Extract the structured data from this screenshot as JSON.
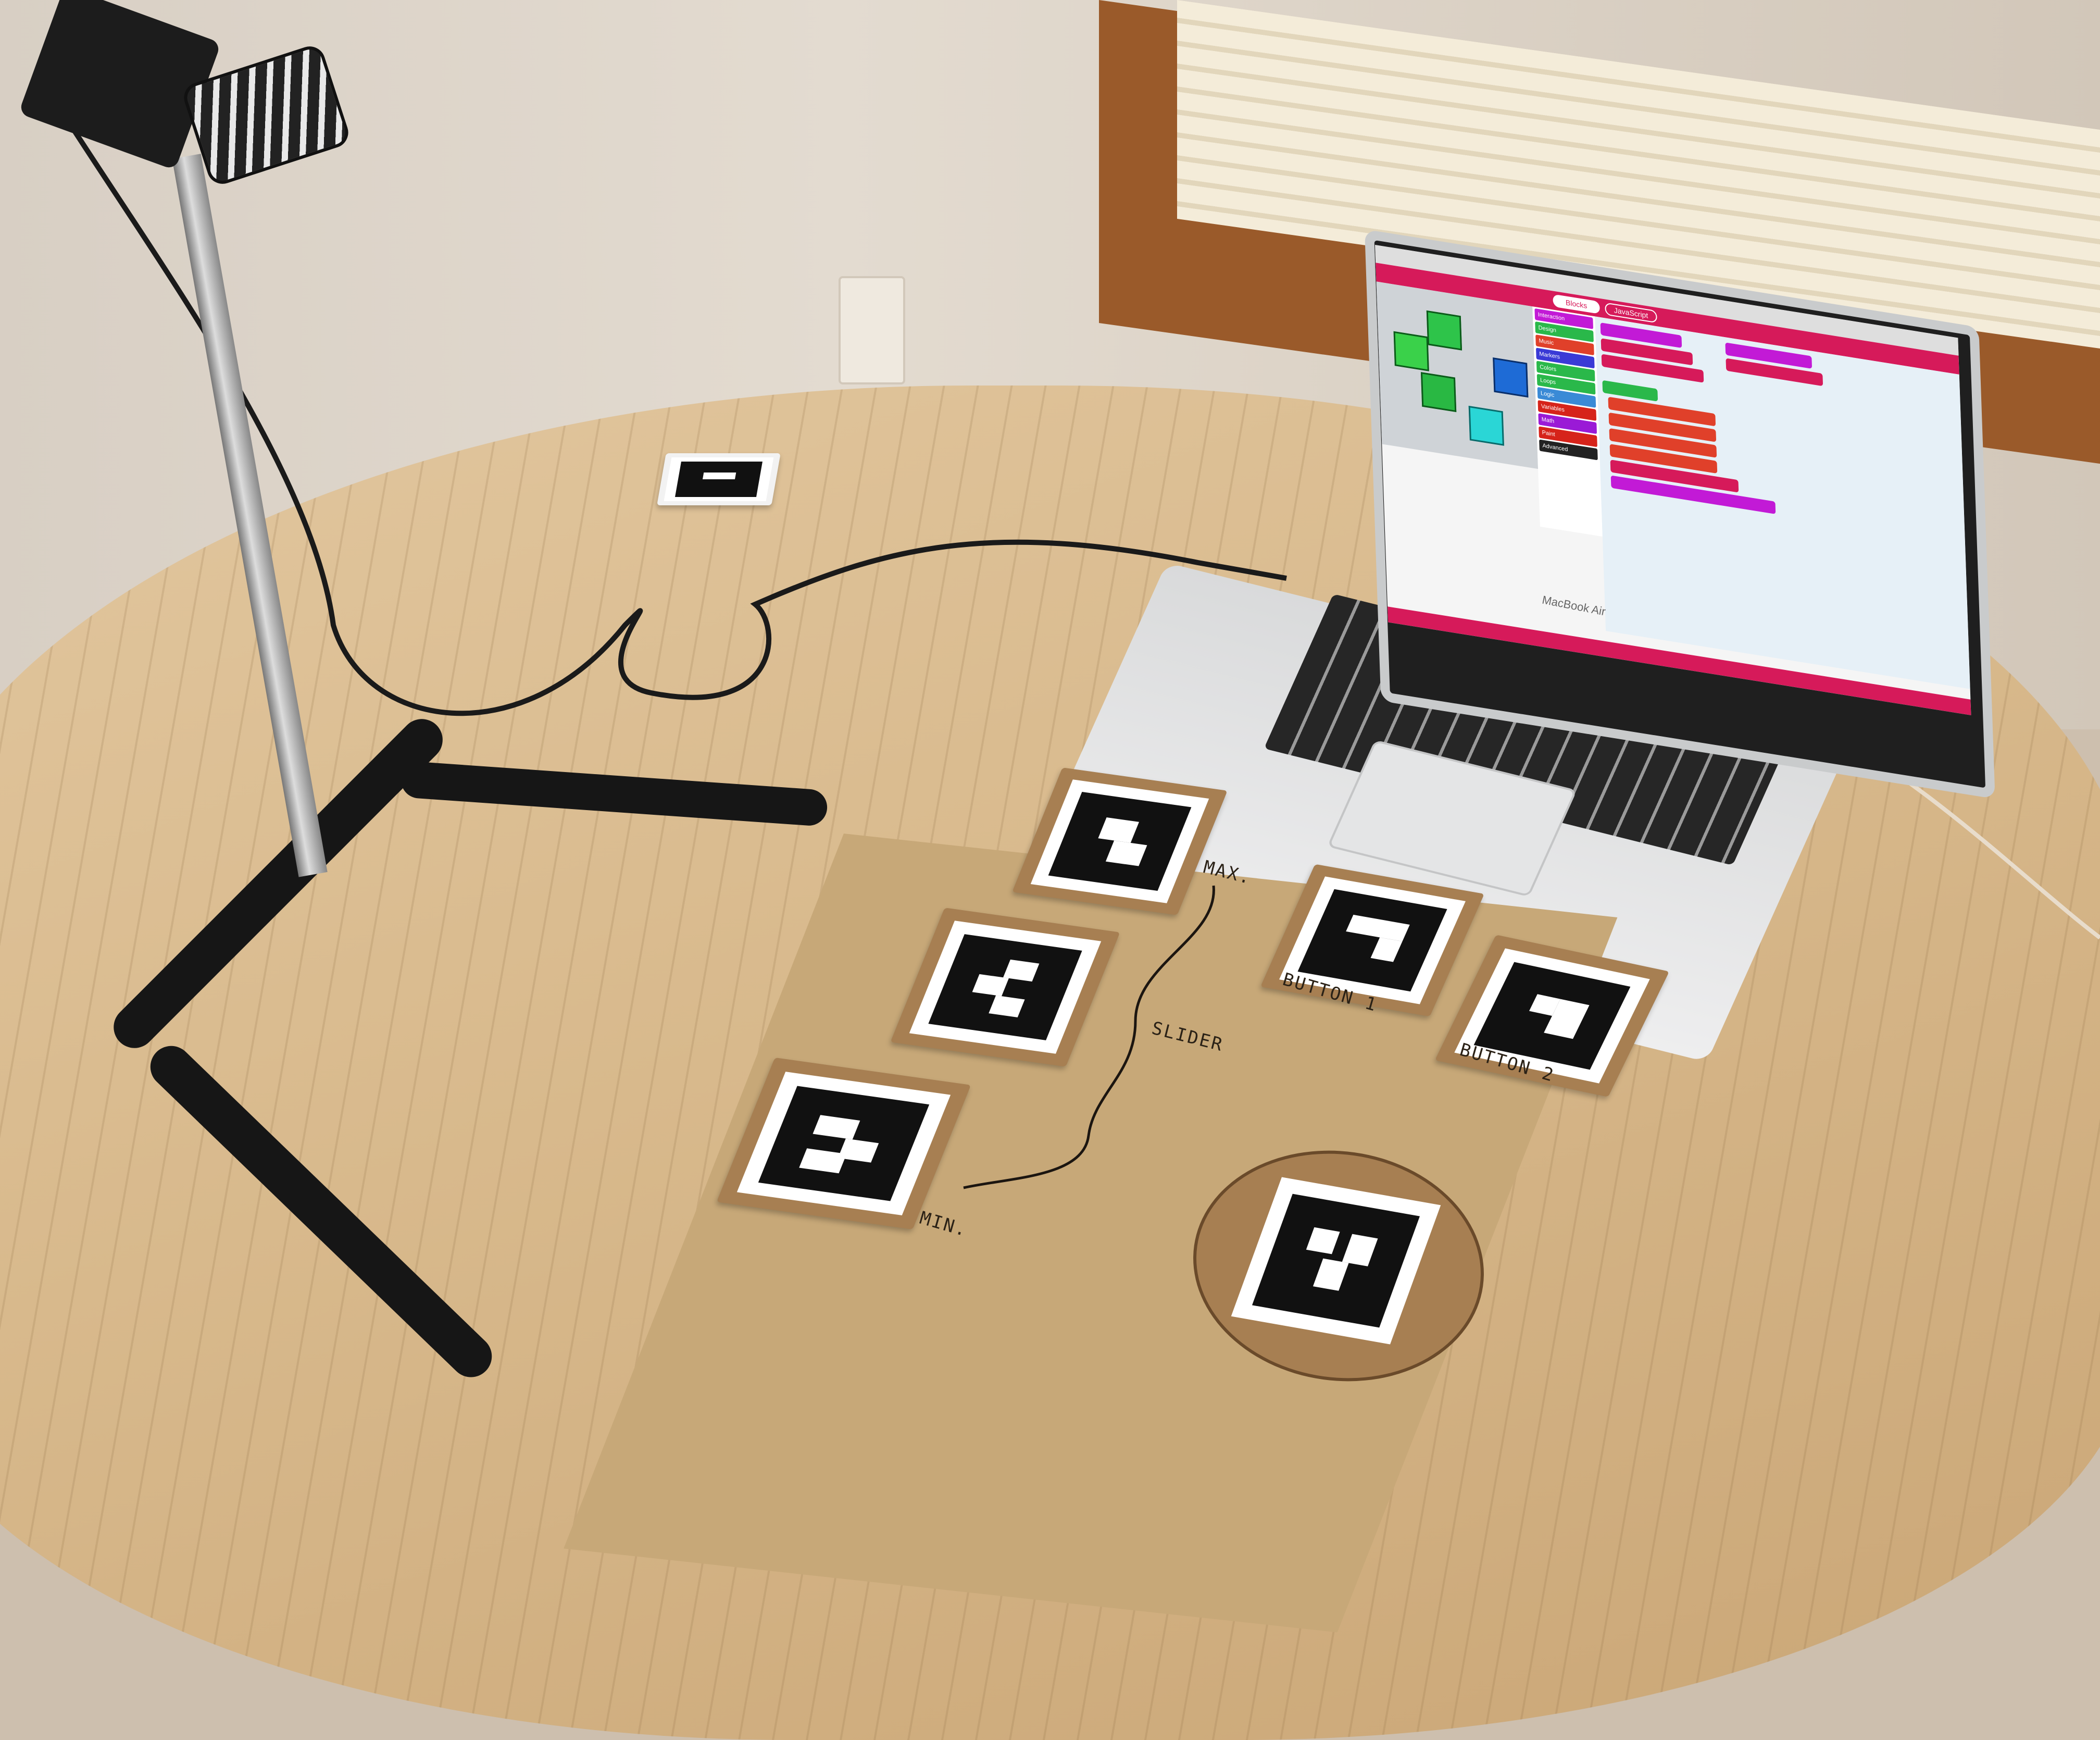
{
  "scene": {
    "laptop": {
      "brand": "MacBook Air",
      "editor": {
        "tab_blocks": "Blocks",
        "tab_javascript": "JavaScript",
        "toolbox": [
          "Interaction",
          "Design",
          "Music",
          "Markers",
          "Colors",
          "Loops",
          "Logic",
          "Variables",
          "Math",
          "Paint",
          "Advanced"
        ]
      }
    },
    "board": {
      "label_max": "MAX.",
      "label_slider": "SLIDER",
      "label_min": "MIN.",
      "label_button1": "BUTTON 1",
      "label_button2": "BUTTON 2"
    }
  }
}
